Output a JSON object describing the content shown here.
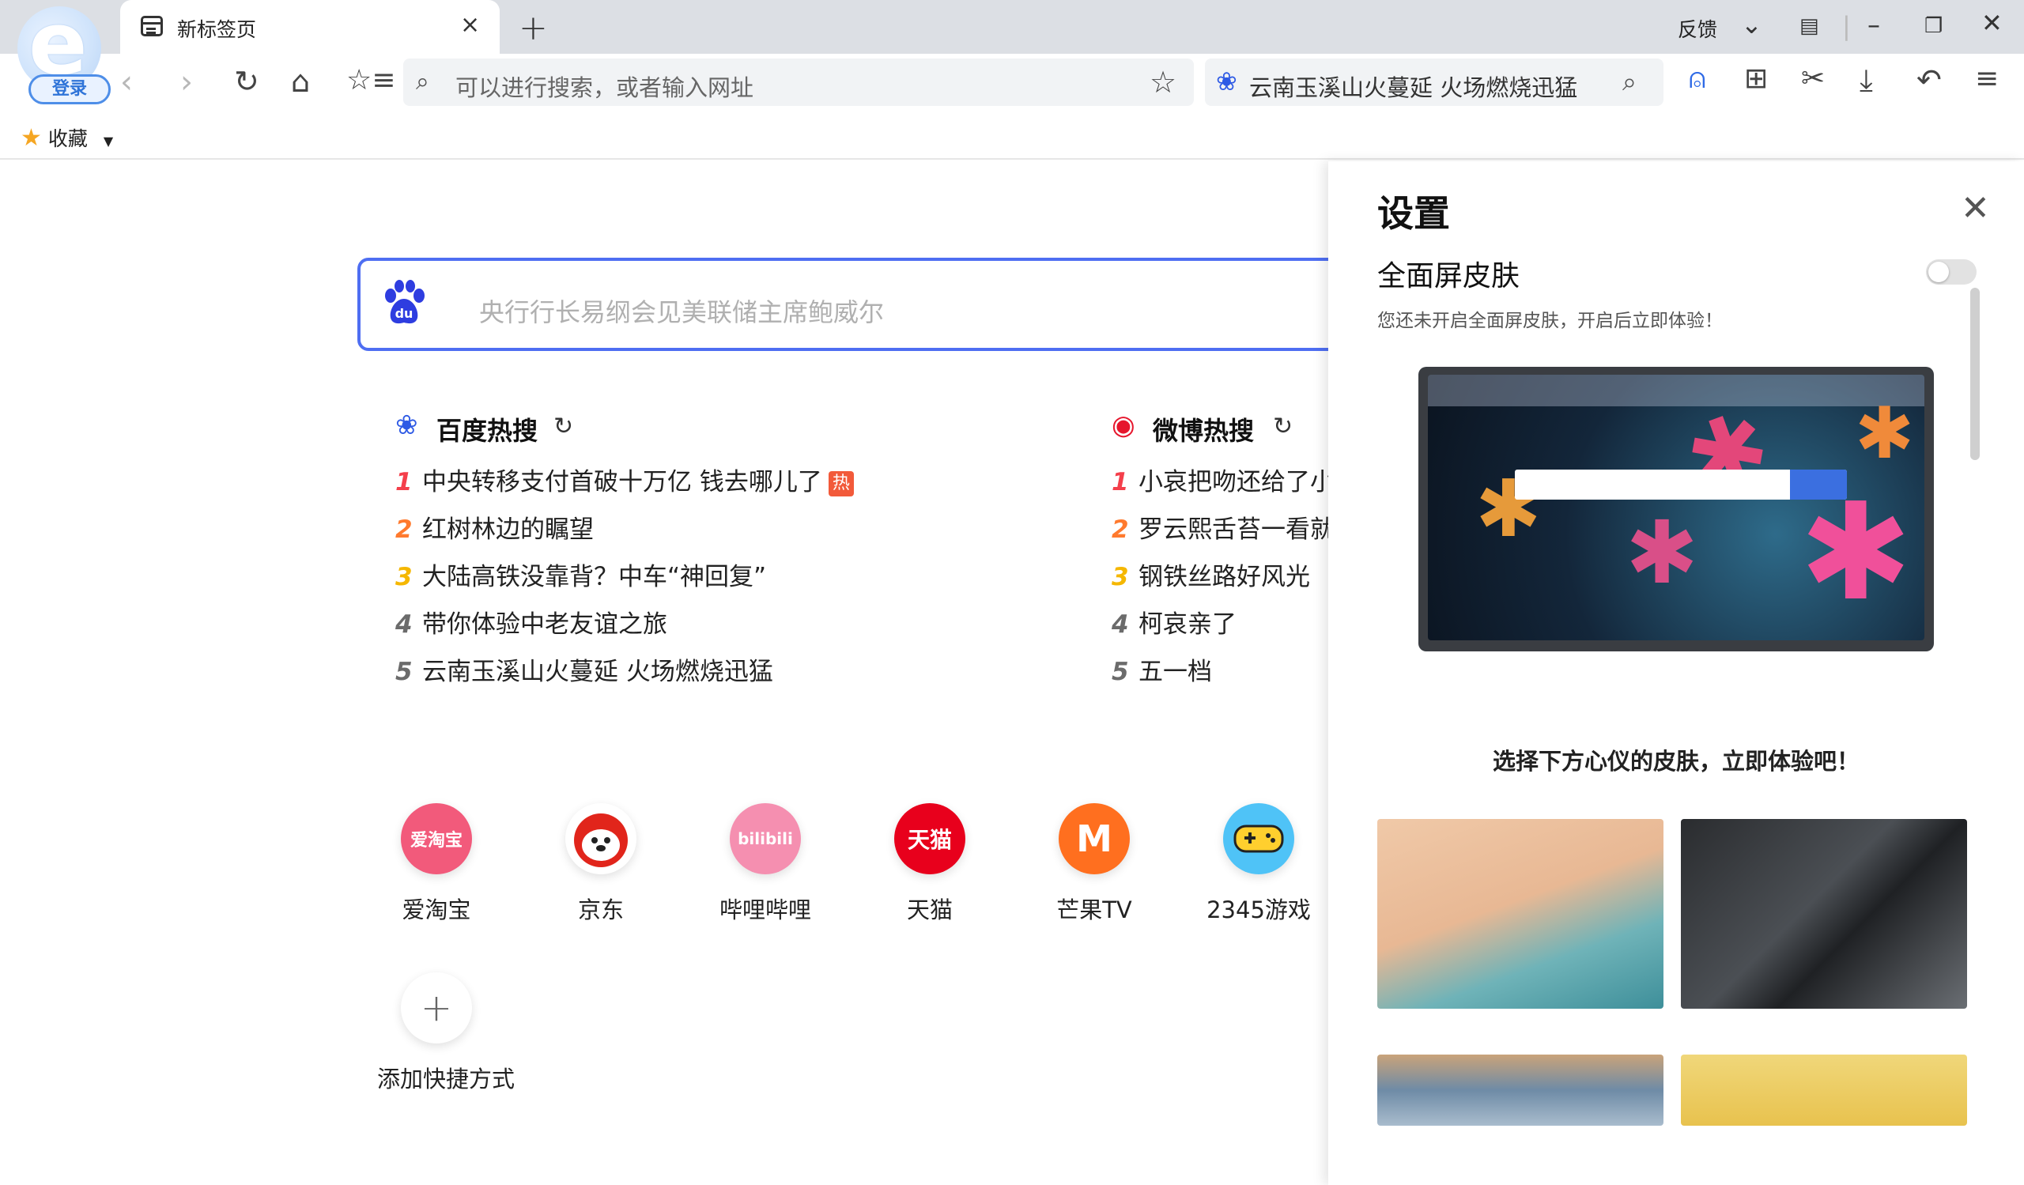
{
  "browser": {
    "login_label": "登录",
    "tab_title": "新标签页",
    "tab_close": "×",
    "new_tab": "+",
    "feedback": "反馈",
    "window_controls": [
      "chevron-down-icon",
      "layout-icon",
      "minimize-icon",
      "restore-icon",
      "close-icon"
    ]
  },
  "toolbar": {
    "address_placeholder": "可以进行搜索，或者输入网址",
    "search_engine_text": "云南玉溪山火蔓延 火场燃烧迅猛",
    "right_icons": [
      "mouse-icon",
      "apps-icon",
      "scissors-icon",
      "download-icon",
      "undo-icon",
      "menu-icon"
    ]
  },
  "bookmarks": {
    "favorites_label": "收藏"
  },
  "search": {
    "placeholder": "央行行长易纲会见美联储主席鲍威尔"
  },
  "baidu_hot": {
    "title": "百度热搜",
    "items": [
      {
        "rank": "1",
        "text": "中央转移支付首破十万亿 钱去哪儿了",
        "badge": "热"
      },
      {
        "rank": "2",
        "text": "红树林边的瞩望"
      },
      {
        "rank": "3",
        "text": "大陆高铁没靠背？中车“神回复”"
      },
      {
        "rank": "4",
        "text": "带你体验中老友谊之旅"
      },
      {
        "rank": "5",
        "text": "云南玉溪山火蔓延 火场燃烧迅猛"
      }
    ]
  },
  "weibo_hot": {
    "title": "微博热搜",
    "items": [
      {
        "rank": "1",
        "text": "小哀把吻还给了小"
      },
      {
        "rank": "2",
        "text": "罗云熙舌苔一看就"
      },
      {
        "rank": "3",
        "text": "钢铁丝路好风光"
      },
      {
        "rank": "4",
        "text": "柯哀亲了"
      },
      {
        "rank": "5",
        "text": "五一档"
      }
    ]
  },
  "shortcuts": [
    {
      "label": "爱淘宝",
      "icon_text": "爱淘宝",
      "color": "#f25a7b"
    },
    {
      "label": "京东",
      "icon_text": "",
      "color": "#ffffff"
    },
    {
      "label": "哔哩哔哩",
      "icon_text": "bilibili",
      "color": "#f58fb0"
    },
    {
      "label": "天猫",
      "icon_text": "天猫",
      "color": "#e8001c"
    },
    {
      "label": "芒果TV",
      "icon_text": "M",
      "color": "#ff6f1f"
    },
    {
      "label": "2345游戏",
      "icon_text": "",
      "color": "#4fc3f7"
    }
  ],
  "add_shortcut": {
    "icon": "+",
    "label": "添加快捷方式"
  },
  "settings": {
    "title": "设置",
    "section": "全面屏皮肤",
    "hint": "您还未开启全面屏皮肤，开启后立即体验！",
    "toggle_on": false,
    "choose_text": "选择下方心仪的皮肤，立即体验吧！"
  },
  "colors": {
    "accent": "#4e6ef2",
    "rank1": "#f43f4b",
    "rank2": "#ff7a2e",
    "rank3": "#f5b700"
  }
}
